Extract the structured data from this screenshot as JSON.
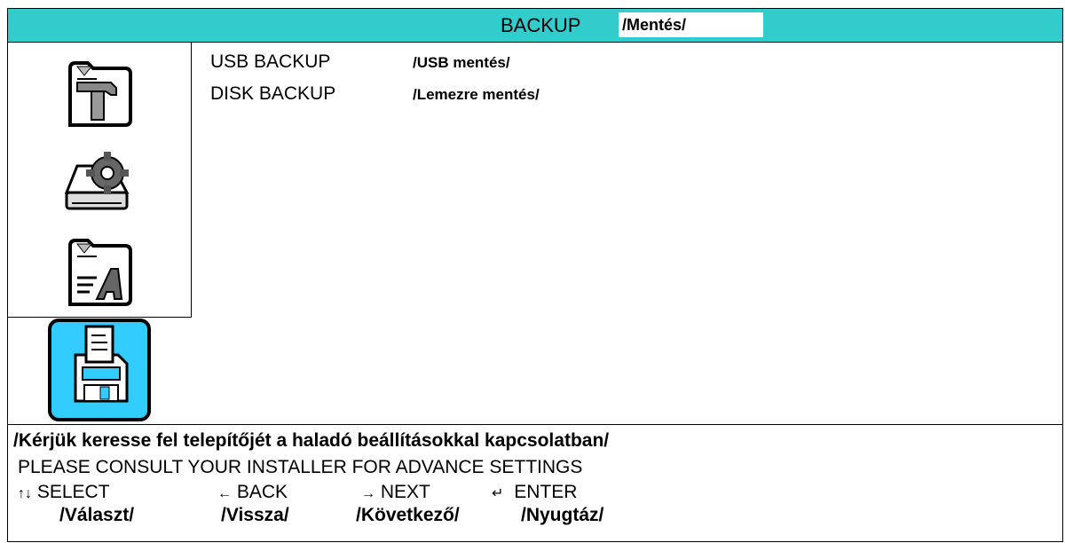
{
  "header": {
    "title": "BACKUP",
    "title_hu": "/Mentés/"
  },
  "sidebar": {
    "icons": [
      {
        "name": "system-tools-icon",
        "selected": false
      },
      {
        "name": "disk-settings-icon",
        "selected": false
      },
      {
        "name": "text-settings-icon",
        "selected": false
      },
      {
        "name": "backup-floppy-icon",
        "selected": true
      }
    ]
  },
  "menu": {
    "items": [
      {
        "label": "USB BACKUP",
        "hint": "/USB mentés/"
      },
      {
        "label": "DISK BACKUP",
        "hint": "/Lemezre mentés/"
      }
    ]
  },
  "footer": {
    "notice_hu": "/Kérjük keresse fel telepítőjét a haladó beállításokkal kapcsolatban/",
    "notice_en": "PLEASE CONSULT YOUR INSTALLER FOR ADVANCE SETTINGS",
    "keys": [
      {
        "glyph": "↑↓",
        "label": "SELECT",
        "hu": "/Választ/"
      },
      {
        "glyph": "←",
        "label": "BACK",
        "hu": "/Vissza/"
      },
      {
        "glyph": "→",
        "label": "NEXT",
        "hu": "/Következő/"
      },
      {
        "glyph": "↵",
        "label": "ENTER",
        "hu": "/Nyugtáz/"
      }
    ]
  },
  "colors": {
    "titlebar": "#33cccc",
    "selected_icon": "#33ccff"
  }
}
